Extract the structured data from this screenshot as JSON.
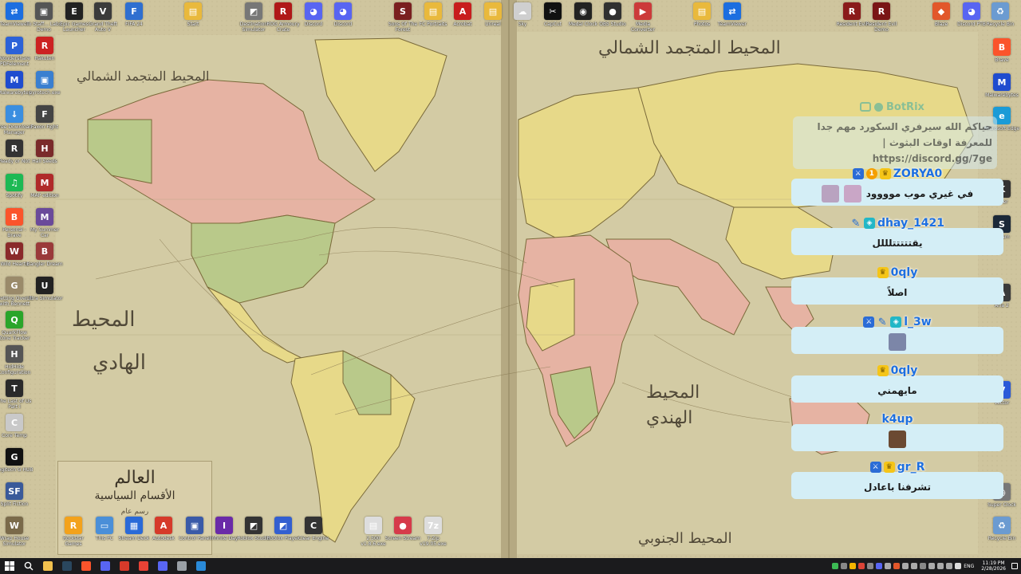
{
  "colors": {
    "paper": "#d2c9a1",
    "land_yellow": "#e8d98a",
    "land_pink": "#e7b3a3",
    "land_green": "#b9c98a",
    "chat_bubble": "#d4eef6",
    "username": "#1d6fe0",
    "taskbar": "#1b1b1d"
  },
  "wallpaper": {
    "ocean_labels": [
      "المحيط المتجمد الشمالي",
      "المحيط المتجمد الشمالي",
      "المحيط",
      "الهادي",
      "المحيط",
      "الهندي",
      "المحيط الجنوبي"
    ],
    "title_box": {
      "title": "العالم",
      "subtitle": "الأقسام السياسية",
      "note": "رسم عام"
    }
  },
  "desktop_icons": {
    "top_row": [
      {
        "label": "TeamViewer",
        "icon": "teamviewer-icon",
        "color": "#1c6ee0",
        "glyph": "⇄"
      },
      {
        "label": "To Staff... Labs Demo",
        "icon": "game-icon",
        "color": "#555555",
        "glyph": "▣"
      },
      {
        "label": "Epic Games Launcher",
        "icon": "epic-games-icon",
        "color": "#222222",
        "glyph": "E"
      },
      {
        "label": "Grand Theft Auto V",
        "icon": "gta-icon",
        "color": "#3b3b3b",
        "glyph": "V"
      },
      {
        "label": "FIFA 24",
        "icon": "fifa-icon",
        "color": "#2f6fd0",
        "glyph": "F"
      },
      {
        "label": "Start",
        "icon": "folder-icon",
        "color": "#e9b93c",
        "glyph": "▤"
      },
      {
        "label": "Destination Simulator",
        "icon": "simulator-icon",
        "color": "#777777",
        "glyph": "◩"
      },
      {
        "label": "ROG Armoury Crate",
        "icon": "rog-icon",
        "color": "#b01818",
        "glyph": "R"
      },
      {
        "label": "Discord",
        "icon": "discord-icon",
        "color": "#5865f2",
        "glyph": "◕"
      },
      {
        "label": "Discord",
        "icon": "discord-icon",
        "color": "#5865f2",
        "glyph": "◕"
      },
      {
        "label": "Sons Of The Forest",
        "icon": "game-icon",
        "color": "#7a1f1f",
        "glyph": "S"
      },
      {
        "label": "FC Portraits",
        "icon": "folder-icon",
        "color": "#e9b93c",
        "glyph": "▤"
      },
      {
        "label": "Acrobat",
        "icon": "acrobat-icon",
        "color": "#c81d1d",
        "glyph": "A"
      },
      {
        "label": "Unreal",
        "icon": "folder-icon",
        "color": "#e9b93c",
        "glyph": "▤"
      },
      {
        "label": "Sky",
        "icon": "sky-icon",
        "color": "#cfcfcf",
        "glyph": "☁"
      },
      {
        "label": "CapCut",
        "icon": "capcut-icon",
        "color": "#111111",
        "glyph": "✂"
      },
      {
        "label": "Medal Clock",
        "icon": "medal-icon",
        "color": "#222222",
        "glyph": "◉"
      },
      {
        "label": "OBS Studio",
        "icon": "obs-icon",
        "color": "#303030",
        "glyph": "●"
      },
      {
        "label": "Media Converter",
        "icon": "media-icon",
        "color": "#cc3a3a",
        "glyph": "▶"
      },
      {
        "label": "Photos",
        "icon": "photos-icon",
        "color": "#e9b93c",
        "glyph": "▤"
      },
      {
        "label": "TeamViewer",
        "icon": "teamviewer-icon",
        "color": "#1c6ee0",
        "glyph": "⇄"
      },
      {
        "label": "Resident Evil",
        "icon": "game-icon",
        "color": "#8a1b1b",
        "glyph": "R"
      },
      {
        "label": "Resident Evil Demo",
        "icon": "game-icon",
        "color": "#7a1515",
        "glyph": "R"
      },
      {
        "label": "Blaze",
        "icon": "blaze-icon",
        "color": "#e2572a",
        "glyph": "◆"
      },
      {
        "label": "Discord PTB",
        "icon": "discord-icon",
        "color": "#5865f2",
        "glyph": "◕"
      },
      {
        "label": "Recycle Bin",
        "icon": "recycle-bin-icon",
        "color": "#6b9bd1",
        "glyph": "♻"
      }
    ],
    "left_column": [
      {
        "label": "Wondershare PDFelement",
        "icon": "pdfelement-icon",
        "color": "#2c62d8",
        "glyph": "P"
      },
      {
        "label": "Malwarebytes",
        "icon": "malwarebytes-icon",
        "color": "#1f4ccf",
        "glyph": "M"
      },
      {
        "label": "Free Download Manager",
        "icon": "download-icon",
        "color": "#3a8ee0",
        "glyph": "↓"
      },
      {
        "label": "Ready or Not",
        "icon": "game-icon",
        "color": "#333333",
        "glyph": "R"
      },
      {
        "label": "Spotify",
        "icon": "spotify-icon",
        "color": "#1db954",
        "glyph": "♫"
      },
      {
        "label": "Personal - Brave",
        "icon": "brave-icon",
        "color": "#fb542b",
        "glyph": "B"
      },
      {
        "label": "Wild Hearts",
        "icon": "game-icon",
        "color": "#8a2a2a",
        "glyph": "W"
      },
      {
        "label": "Getting Over It with Bennett Foddy",
        "icon": "game-icon",
        "color": "#9a8a6a",
        "glyph": "G"
      },
      {
        "label": "QuarkFlow Zone Tracker",
        "icon": "app-icon",
        "color": "#2aa52a",
        "glyph": "Q"
      },
      {
        "label": "HidHide Configuration",
        "icon": "app-icon",
        "color": "#555555",
        "glyph": "H"
      },
      {
        "label": "The Last of Us Part I",
        "icon": "game-icon",
        "color": "#2a2a2a",
        "glyph": "T"
      },
      {
        "label": "Core Temp",
        "icon": "coretemp-icon",
        "color": "#c9c9c9",
        "glyph": "C"
      },
      {
        "label": "Logitech G HUB",
        "icon": "logitech-icon",
        "color": "#111111",
        "glyph": "G"
      },
      {
        "label": "Split Fiction",
        "icon": "game-icon",
        "color": "#3a5a9a",
        "glyph": "SF"
      },
      {
        "label": "Wrap House Simulator",
        "icon": "game-icon",
        "color": "#7a6a4a",
        "glyph": "W"
      }
    ],
    "second_column": [
      {
        "label": "Rakuten",
        "icon": "app-icon",
        "color": "#cc2222",
        "glyph": "R"
      },
      {
        "label": "pyrotech.exe",
        "icon": "exe-icon",
        "color": "#3a7fd0",
        "glyph": "▣"
      },
      {
        "label": "Faxon Fight",
        "icon": "game-icon",
        "color": "#444444",
        "glyph": "F"
      },
      {
        "label": "Hall Seeds",
        "icon": "game-icon",
        "color": "#7a2a2a",
        "glyph": "H"
      },
      {
        "label": "MAP edition",
        "icon": "app-icon",
        "color": "#b02a2a",
        "glyph": "M"
      },
      {
        "label": "My Summer Car",
        "icon": "game-icon",
        "color": "#6a4a9a",
        "glyph": "M"
      },
      {
        "label": "Bangler Dream",
        "icon": "game-icon",
        "color": "#9a3a3a",
        "glyph": "B"
      },
      {
        "label": "Ultra Simulator",
        "icon": "game-icon",
        "color": "#222222",
        "glyph": "U"
      }
    ],
    "bottom_row": [
      {
        "label": "Rockstar Games Launcher",
        "icon": "rockstar-icon",
        "color": "#f3a21c",
        "glyph": "R"
      },
      {
        "label": "This PC",
        "icon": "this-pc-icon",
        "color": "#4a8fd8",
        "glyph": "▭"
      },
      {
        "label": "Stream Deck",
        "icon": "streamdeck-icon",
        "color": "#2a6ad8",
        "glyph": "▦"
      },
      {
        "label": "Autodesk",
        "icon": "autodesk-icon",
        "color": "#d63a2a",
        "glyph": "A"
      },
      {
        "label": "Control Panel",
        "icon": "control-panel-icon",
        "color": "#3a5aa8",
        "glyph": "▣"
      },
      {
        "label": "Infinite Day",
        "icon": "game-icon",
        "color": "#6a2aa8",
        "glyph": "I"
      },
      {
        "label": "Roblox Studio",
        "icon": "roblox-icon",
        "color": "#333333",
        "glyph": "◩"
      },
      {
        "label": "Roblox Player",
        "icon": "roblox-icon",
        "color": "#335fd0",
        "glyph": "◩"
      },
      {
        "label": "Clear Engine",
        "icon": "app-icon",
        "color": "#333333",
        "glyph": "C"
      },
      {
        "label": "2.500 v1.8.6.exe",
        "icon": "exe-icon",
        "color": "#dddddd",
        "glyph": "▤"
      },
      {
        "label": "Screen Stream",
        "icon": "app-icon",
        "color": "#d63a4a",
        "glyph": "●"
      },
      {
        "label": "7-Zip v19.05.exe",
        "icon": "7zip-icon",
        "color": "#dddddd",
        "glyph": "7z"
      }
    ],
    "right_column": [
      {
        "label": "Brave",
        "icon": "brave-icon",
        "color": "#fb542b",
        "glyph": "B"
      },
      {
        "label": "Malwarebytes",
        "icon": "malwarebytes-icon",
        "color": "#1f4ccf",
        "glyph": "M"
      },
      {
        "label": "Microsoft Edge",
        "icon": "edge-icon",
        "color": "#1a9bd7",
        "glyph": "e"
      },
      {
        "label": "Killer",
        "icon": "app-icon",
        "color": "#333333",
        "glyph": "K"
      },
      {
        "label": "Steam",
        "icon": "steam-icon",
        "color": "#1b2838",
        "glyph": "S"
      },
      {
        "label": "Aria 2",
        "icon": "app-icon",
        "color": "#3a3a3a",
        "glyph": "A"
      },
      {
        "label": "Vector",
        "icon": "app-icon",
        "color": "#2a5ad8",
        "glyph": "V"
      },
      {
        "label": "Super Clock",
        "icon": "clock-icon",
        "color": "#777777",
        "glyph": "◷"
      },
      {
        "label": "Recycle Bin",
        "icon": "recycle-bin-icon",
        "color": "#6b9bd1",
        "glyph": "♻"
      }
    ]
  },
  "chat": {
    "bot_name": "BotRix",
    "bot_message": "حياكم الله سيرفري السكورد مهم جدا للمعرفة اوقات البثوث | https://discord.gg/7ge",
    "messages": [
      {
        "user": "ZORYA0",
        "badges": [
          "sword",
          "one",
          "crown"
        ],
        "text": "في غيري موب موووود",
        "emotes": [
          "#c9a6c6",
          "#b9a3c0"
        ]
      },
      {
        "user": "dhay_1421",
        "badges": [
          "feather",
          "gem"
        ],
        "text": "يقتتتتتلللل",
        "emotes": []
      },
      {
        "user": "0qly",
        "badges": [
          "crown"
        ],
        "text": "اصلاً",
        "emotes": []
      },
      {
        "user": "l_3w",
        "badges": [
          "sword",
          "feather",
          "gem"
        ],
        "text": "",
        "emotes": [
          "#7c86a8"
        ]
      },
      {
        "user": "0qly",
        "badges": [
          "crown"
        ],
        "text": "مايهمني",
        "emotes": []
      },
      {
        "user": "k4up",
        "badges": [],
        "text": "",
        "emotes": [
          "#6b4a32"
        ]
      },
      {
        "user": "gr_R",
        "badges": [
          "sword",
          "crown"
        ],
        "text": "تشرفنا باعادل",
        "emotes": []
      }
    ]
  },
  "taskbar": {
    "apps": [
      {
        "name": "file-explorer",
        "color": "#f2c14e"
      },
      {
        "name": "steam",
        "color": "#2a475e"
      },
      {
        "name": "brave",
        "color": "#fb542b"
      },
      {
        "name": "discord",
        "color": "#5865f2"
      },
      {
        "name": "autodesk",
        "color": "#d63a2a"
      },
      {
        "name": "chrome",
        "color": "#e94235"
      },
      {
        "name": "discord-ptb",
        "color": "#5865f2"
      },
      {
        "name": "settings",
        "color": "#9aa0a6"
      },
      {
        "name": "app",
        "color": "#2a8ad8"
      }
    ],
    "tray_colors": [
      "#3cba54",
      "#888888",
      "#f4b400",
      "#db4437",
      "#888888",
      "#5865f2",
      "#aaaaaa",
      "#e2572a",
      "#aaaaaa",
      "#aaaaaa",
      "#888888",
      "#aaaaaa",
      "#aaaaaa",
      "#aaaaaa",
      "#dddddd"
    ],
    "language": "ENG",
    "time": "11:19 PM",
    "date": "2/28/2026"
  }
}
